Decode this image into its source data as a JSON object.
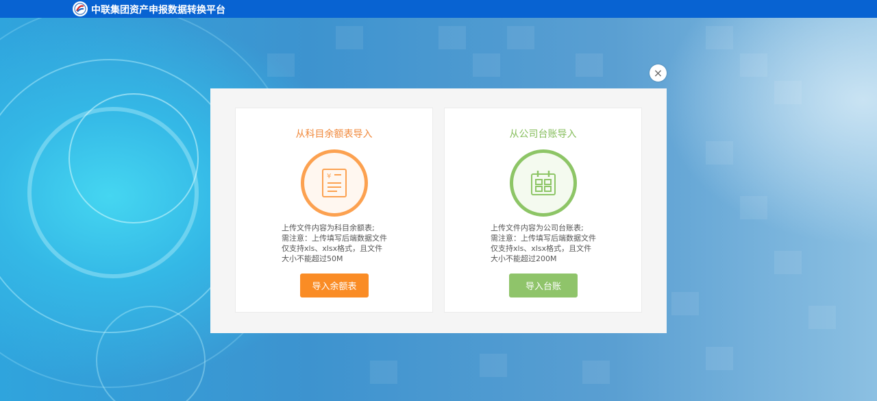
{
  "header": {
    "app_title": "中联集团资产申报数据转换平台",
    "bar_color": "#0863d2"
  },
  "dialog": {
    "close_label": "×",
    "cards": [
      {
        "title": "从科目余额表导入",
        "icon": "yen-document-icon",
        "desc_line1": "上传文件内容为科目余额表;",
        "desc_line2": "需注意：上传填写后端数据文件 仅支持xls、xlsx格式，且文件大小不能超过50M",
        "button_label": "导入余额表",
        "accent": "#f0883a",
        "button_color": "#fa8c25"
      },
      {
        "title": "从公司台账导入",
        "icon": "calendar-ledger-icon",
        "desc_line1": "上传文件内容为公司台账表;",
        "desc_line2": "需注意：上传填写后端数据文件 仅支持xls、xlsx格式，且文件大小不能超过200M",
        "button_label": "导入台账",
        "accent": "#85bd5b",
        "button_color": "#8fc46a"
      }
    ]
  }
}
